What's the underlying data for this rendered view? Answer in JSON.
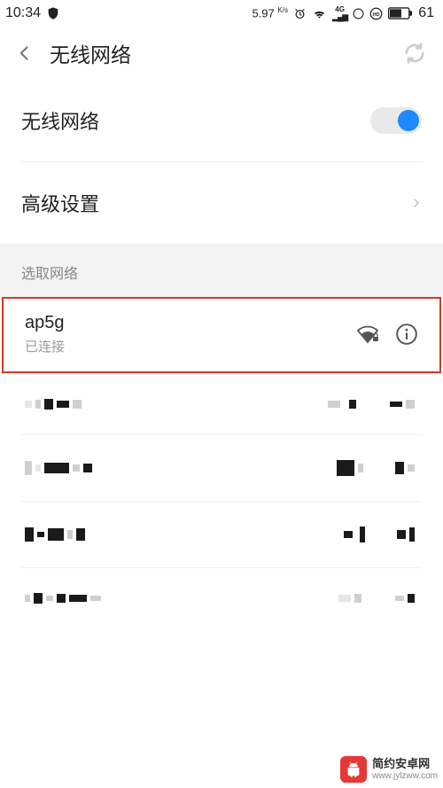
{
  "status": {
    "time": "10:34",
    "speed_value": "5.97",
    "speed_unit": "K/s",
    "signal_label": "4G",
    "battery_pct": "61"
  },
  "header": {
    "title": "无线网络"
  },
  "rows": {
    "wifi_label": "无线网络",
    "wifi_on": true,
    "advanced_label": "高级设置"
  },
  "group": {
    "select_label": "选取网络"
  },
  "connected": {
    "name": "ap5g",
    "status": "已连接"
  },
  "watermark": {
    "name": "简约安卓网",
    "url": "www.jylzww.com"
  }
}
